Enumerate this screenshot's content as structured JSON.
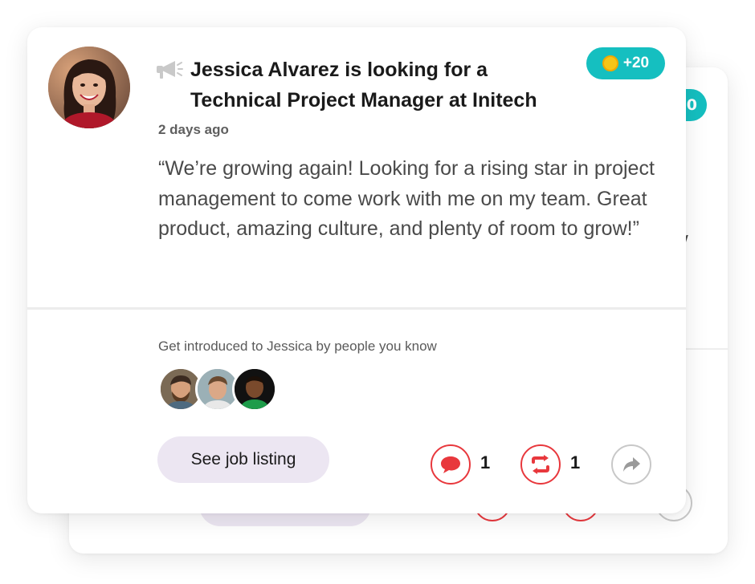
{
  "post": {
    "title_line1": "Jessica Alvarez is looking for a",
    "title_line2": "Technical Project Manager at Initech",
    "badge_points": "+20",
    "timestamp": "2 days ago",
    "quote": "“We’re growing again! Looking for a rising star in project management to come work with me on my team. Great product, amazing culture, and plenty of room to grow!”",
    "intro_text": "Get introduced to Jessica by people you know",
    "cta_label": "See job listing",
    "comment_count": "1",
    "repost_count": "1"
  },
  "back_card": {
    "badge_fragment": "0",
    "text_fragment": "/"
  },
  "colors": {
    "accent_teal": "#15bfc0",
    "action_red": "#e8383d",
    "cta_bg": "#ece6f2",
    "coin": "#f5c518"
  },
  "icons": {
    "post_type": "megaphone-icon",
    "points": "coin-icon",
    "comment": "speech-bubble-icon",
    "repost": "repost-arrows-icon",
    "share": "share-arrow-icon"
  }
}
